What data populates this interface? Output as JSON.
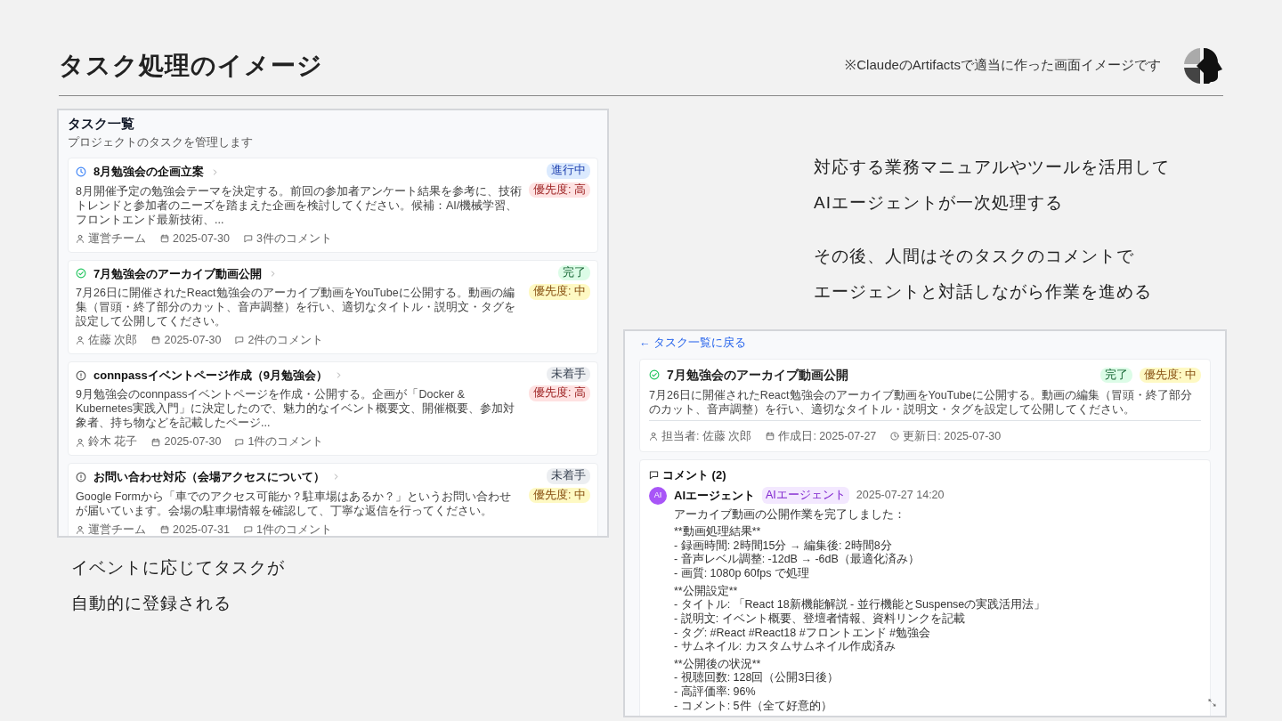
{
  "slide": {
    "title": "タスク処理のイメージ",
    "note": "※ClaudeのArtifactsで適当に作った画面イメージです"
  },
  "task_list": {
    "title": "タスク一覧",
    "subtitle": "プロジェクトのタスクを管理します",
    "tasks": [
      {
        "title": "8月勉強会の企画立案",
        "status": {
          "kind": "in_progress",
          "label": "進行中"
        },
        "priority": {
          "kind": "high",
          "label": "優先度: 高"
        },
        "description": "8月開催予定の勉強会テーマを決定する。前回の参加者アンケート結果を参考に、技術トレンドと参加者のニーズを踏まえた企画を検討してください。候補：AI/機械学習、フロントエンド最新技術、...",
        "assignee": "運営チーム",
        "date": "2025-07-30",
        "comments": "3件のコメント"
      },
      {
        "title": "7月勉強会のアーカイブ動画公開",
        "status": {
          "kind": "done",
          "label": "完了"
        },
        "priority": {
          "kind": "medium",
          "label": "優先度: 中"
        },
        "description": "7月26日に開催されたReact勉強会のアーカイブ動画をYouTubeに公開する。動画の編集（冒頭・終了部分のカット、音声調整）を行い、適切なタイトル・説明文・タグを設定して公開してください。",
        "assignee": "佐藤 次郎",
        "date": "2025-07-30",
        "comments": "2件のコメント"
      },
      {
        "title": "connpassイベントページ作成（9月勉強会）",
        "status": {
          "kind": "todo",
          "label": "未着手"
        },
        "priority": {
          "kind": "high",
          "label": "優先度: 高"
        },
        "description": "9月勉強会のconnpassイベントページを作成・公開する。企画が「Docker & Kubernetes実践入門」に決定したので、魅力的なイベント概要文、開催概要、参加対象者、持ち物などを記載したページ...",
        "assignee": "鈴木 花子",
        "date": "2025-07-30",
        "comments": "1件のコメント"
      },
      {
        "title": "お問い合わせ対応（会場アクセスについて）",
        "status": {
          "kind": "todo",
          "label": "未着手"
        },
        "priority": {
          "kind": "medium",
          "label": "優先度: 中"
        },
        "description": "Google Formから「車でのアクセス可能か？駐車場はあるか？」というお問い合わせが届いています。会場の駐車場情報を確認して、丁寧な返信を行ってください。",
        "assignee": "運営チーム",
        "date": "2025-07-31",
        "comments": "1件のコメント"
      }
    ]
  },
  "caption_left": {
    "lines": [
      "イベントに応じてタスクが",
      "自動的に登録される"
    ]
  },
  "caption_right": [
    {
      "lines": [
        "対応する業務マニュアルやツールを活用して",
        "AIエージェントが一次処理する"
      ]
    },
    {
      "lines": [
        "その後、人間はそのタスクのコメントで",
        "エージェントと対話しながら作業を進める"
      ]
    }
  ],
  "task_detail": {
    "back_link": "← タスク一覧に戻る",
    "title": "7月勉強会のアーカイブ動画公開",
    "status": {
      "kind": "done",
      "label": "完了"
    },
    "priority": {
      "kind": "medium",
      "label": "優先度: 中"
    },
    "description": "7月26日に開催されたReact勉強会のアーカイブ動画をYouTubeに公開する。動画の編集（冒頭・終了部分のカット、音声調整）を行い、適切なタイトル・説明文・タグを設定して公開してください。",
    "assignee": "担当者: 佐藤 次郎",
    "created": "作成日: 2025-07-27",
    "updated": "更新日: 2025-07-30",
    "comments_title": "コメント (2)",
    "comment": {
      "avatar": "AI",
      "author": "AIエージェント",
      "tag": "AIエージェント",
      "time": "2025-07-27 14:20",
      "blocks": [
        {
          "lines": [
            "アーカイブ動画の公開作業を完了しました："
          ]
        },
        {
          "lines": [
            "**動画処理結果**",
            "- 録画時間: 2時間15分 → 編集後: 2時間8分",
            "- 音声レベル調整: -12dB → -6dB（最適化済み）",
            "- 画質: 1080p 60fps で処理"
          ]
        },
        {
          "lines": [
            "**公開設定**",
            "- タイトル: 「React 18新機能解説 - 並行機能とSuspenseの実践活用法」",
            "- 説明文: イベント概要、登壇者情報、資料リンクを記載",
            "- タグ: #React #React18 #フロントエンド #勉強会",
            "- サムネイル: カスタムサムネイル作成済み"
          ]
        },
        {
          "lines": [
            "**公開後の状況**",
            "- 視聴回数: 128回（公開3日後）",
            "- 高評価率: 96%",
            "- コメント: 5件（全て好意的）"
          ]
        }
      ]
    }
  }
}
